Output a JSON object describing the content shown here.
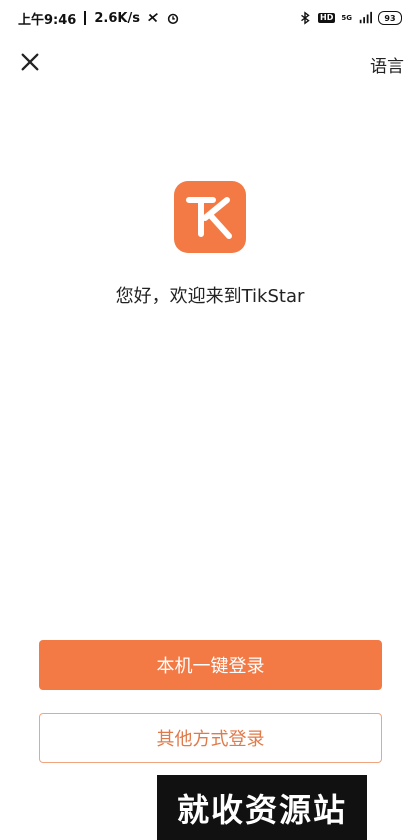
{
  "status_bar": {
    "time": "上午9:46",
    "speed": "2.6K/s",
    "hd": "HD",
    "network": "5G",
    "battery": "93"
  },
  "nav": {
    "language_label": "语言",
    "close_icon": "close-icon"
  },
  "welcome": {
    "text": "您好，欢迎来到TikStar"
  },
  "actions": {
    "primary_label": "本机一键登录",
    "secondary_label": "其他方式登录"
  },
  "watermark": {
    "text": "就收资源站"
  },
  "colors": {
    "accent": "#f47a45",
    "secondary_text": "#e07a4a",
    "secondary_border": "#f0a480"
  }
}
